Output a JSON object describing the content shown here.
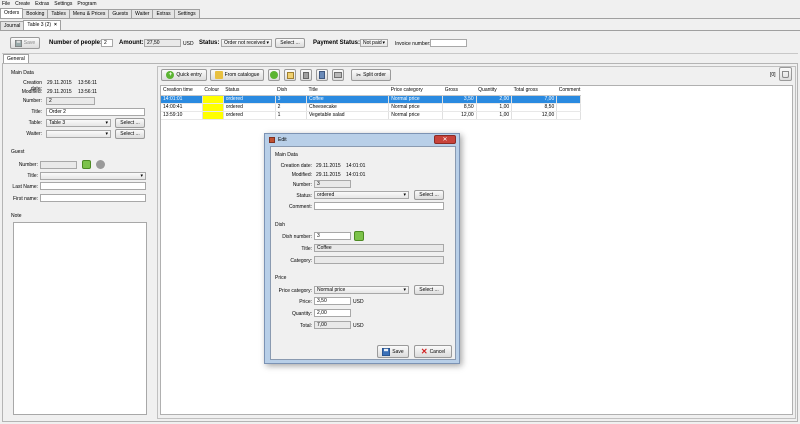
{
  "menu": [
    "File",
    "Create",
    "Extras",
    "Settings",
    "Program"
  ],
  "main_tabs": [
    "Orders",
    "Booking",
    "Tables",
    "Menu & Prices",
    "Guests",
    "Waiter",
    "Extras",
    "Settings"
  ],
  "sub_tabs": [
    "Journal",
    "Table 3 (2)"
  ],
  "sub_tab_close": "×",
  "toolbar": {
    "save": "Save",
    "people_label": "Number of people:",
    "people_value": "2",
    "amount_label": "Amount:",
    "amount_value": "27,50",
    "currency": "USD",
    "status_label": "Status:",
    "status_value": "Order not received",
    "select": "Select ...",
    "payment_label": "Payment Status:",
    "payment_value": "Not paid",
    "invoice_label": "Invoice number:",
    "invoice_value": ""
  },
  "general_tab": "General",
  "main_data": {
    "heading": "Main Data",
    "creation_label": "Creation date:",
    "creation_date": "29.11.2015",
    "creation_time": "13:56:11",
    "modified_label": "Modified:",
    "modified_date": "29.11.2015",
    "modified_time": "13:56:11",
    "number_label": "Number:",
    "number_value": "2",
    "title_label": "Title:",
    "title_value": "Order 2",
    "table_label": "Table:",
    "table_value": "Table 3",
    "waiter_label": "Waiter:",
    "waiter_value": "",
    "select": "Select ..."
  },
  "guest": {
    "heading": "Guest",
    "number_label": "Number:",
    "title_label": "Title:",
    "lastname_label": "Last Name:",
    "firstname_label": "First name:"
  },
  "note": {
    "heading": "Note"
  },
  "actions": {
    "quick_entry": "Quick entry",
    "from_catalogue": "From catalogue",
    "split_order": "Split order",
    "count": "[0]"
  },
  "items_table": {
    "columns": [
      "Creation time",
      "Colour",
      "Status",
      "Dish",
      "Title",
      "Price category",
      "Gross",
      "Quantity",
      "Total gross",
      "Comment"
    ],
    "rows": [
      {
        "time": "14:01:01",
        "colour": "#ffff00",
        "status": "ordered",
        "dish": "3",
        "title": "Coffee",
        "price_category": "Normal price",
        "gross": "3,50",
        "quantity": "2,00",
        "total": "7,00",
        "comment": "",
        "selected": true
      },
      {
        "time": "14:00:41",
        "colour": "#ffff00",
        "status": "ordered",
        "dish": "2",
        "title": "Cheesecake",
        "price_category": "Normal price",
        "gross": "8,50",
        "quantity": "1,00",
        "total": "8,50",
        "comment": "",
        "selected": false
      },
      {
        "time": "13:59:10",
        "colour": "#ffff00",
        "status": "ordered",
        "dish": "1",
        "title": "Vegetable salad",
        "price_category": "Normal price",
        "gross": "12,00",
        "quantity": "1,00",
        "total": "12,00",
        "comment": "",
        "selected": false
      }
    ]
  },
  "dialog": {
    "title": "Edit",
    "close": "✕",
    "main_heading": "Main Data",
    "creation_label": "Creation date:",
    "creation_date": "29.11.2015",
    "creation_time": "14:01:01",
    "modified_label": "Modified:",
    "modified_date": "29.11.2015",
    "modified_time": "14:01:01",
    "number_label": "Number:",
    "number_value": "3",
    "status_label": "Status:",
    "status_value": "ordered",
    "comment_label": "Comment:",
    "comment_value": "",
    "dish_heading": "Dish",
    "dish_number_label": "Dish number:",
    "dish_number_value": "3",
    "dish_title_label": "Title:",
    "dish_title_value": "Coffee",
    "category_label": "Category:",
    "category_value": "",
    "price_heading": "Price",
    "price_category_label": "Price category:",
    "price_category_value": "Normal price",
    "price_label": "Price:",
    "price_value": "3,50",
    "quantity_label": "Quantity:",
    "quantity_value": "2,00",
    "total_label": "Total:",
    "total_value": "7,00",
    "currency": "USD",
    "select": "Select ...",
    "save": "Save",
    "cancel": "Cancel"
  },
  "colors": {
    "selection": "#2a8ae0",
    "row_colour": "#ffff00",
    "dialog_frame": "#b8cfe8"
  }
}
